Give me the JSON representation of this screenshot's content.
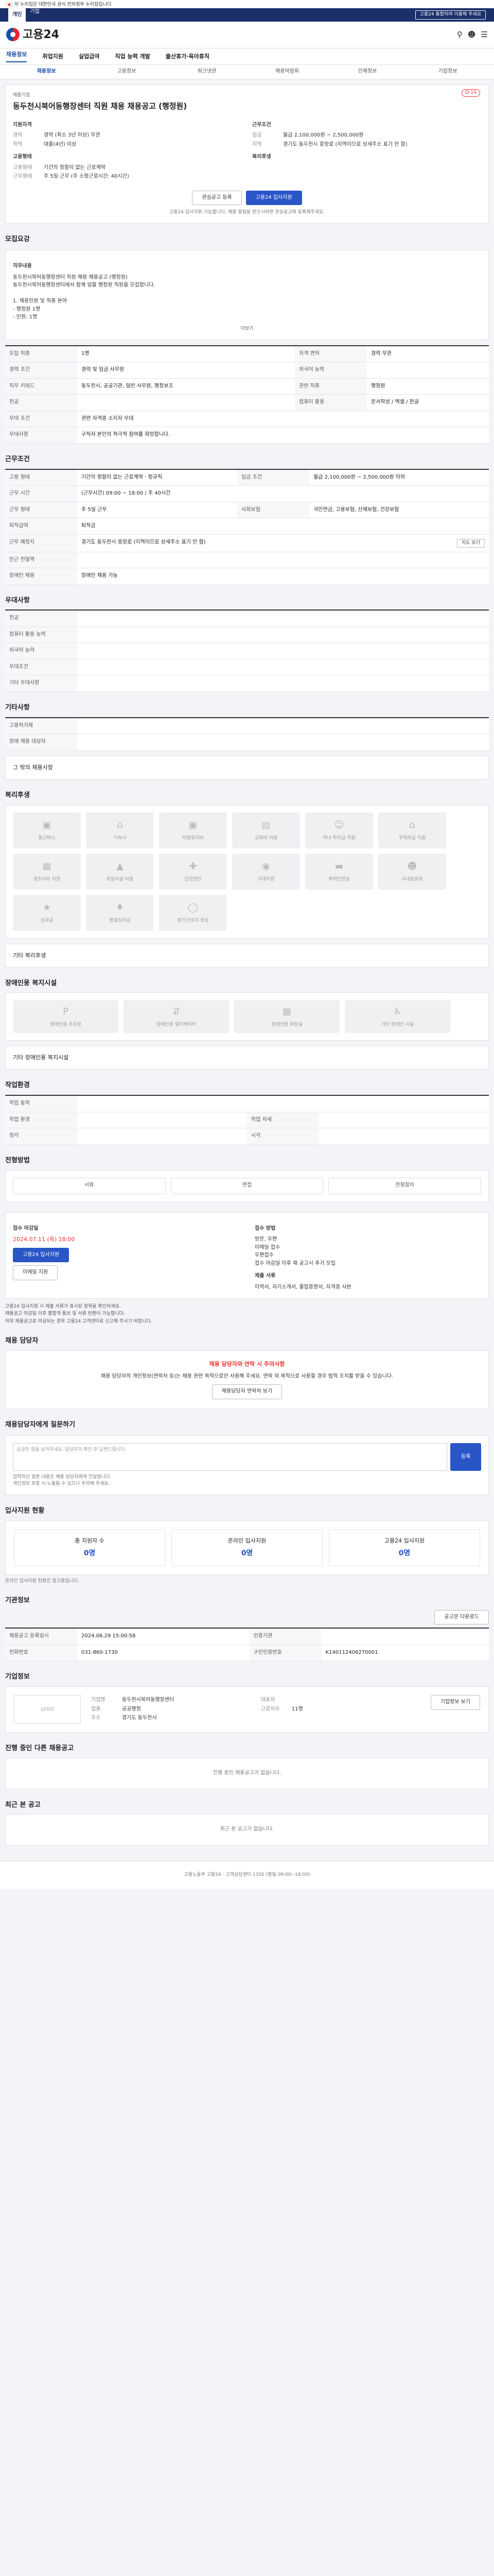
{
  "gov_banner": "이 누리집은 대한민국 공식 전자정부 누리집입니다.",
  "util": {
    "tabs": [
      "개인",
      "기업"
    ],
    "right": "고용24 통합하여 이용해 주세요"
  },
  "logo": "고용24",
  "gnb": [
    "채용정보",
    "취업지원",
    "실업급여",
    "직업 능력 개발",
    "출산휴가·육아휴직"
  ],
  "subnav": [
    "채용정보",
    "고용정보",
    "워크넷관",
    "채용박람회",
    "인재정보",
    "기업정보"
  ],
  "job": {
    "company": "채용기업",
    "title": "동두천시북어동행장센터 직원 채용 채용공고 (행정원)",
    "badge": "D-14",
    "left_title": "지원자격",
    "left": [
      [
        "경력",
        "경력 (최소 3년 이상) 무관"
      ],
      [
        "학력",
        "대졸(4년) 이상"
      ]
    ],
    "right_title": "근무조건",
    "right": [
      [
        "임금",
        "월급 2,100,000원 ~ 2,500,000원"
      ],
      [
        "지역",
        "경기도 동두천시 중앙로 (지역이므로 상세주소 표기 안 함)"
      ]
    ],
    "bottom_left_title": "고용형태",
    "bottom_left": [
      [
        "고용형태",
        "기간의 정함이 없는 근로계약"
      ],
      [
        "근무형태",
        "주 5일 근무 (주 소정근로시간: 40시간)"
      ]
    ],
    "bottom_right_title": "복리후생",
    "bottom_right": [
      [
        "",
        ""
      ]
    ],
    "save": "관심공고 등록",
    "apply": "고용24 입사지원",
    "note": "고용24 입사지원 가능합니다. 채용 알림을 받으시려면 관심공고에 등록해주세요."
  },
  "s_detail": {
    "title": "모집요강",
    "sub": "직무내용",
    "text": "동두천시북어동행장센터 직원 채용 채용공고 (행정원)\n동두천시북어동행장센터에서 함께 일할 행정원 직원을 모집합니다.\n\n1. 채용인원 및 직종 분야\n  - 행정원 1명\n  - 인원: 1명",
    "more": "더보기"
  },
  "s_rows": [
    [
      "모집 직종",
      "1명"
    ],
    [
      "경력 조건",
      "경력 및 임금 사무원"
    ],
    [
      "직무 키워드",
      "동두천시, 공공기관, 일반 사무원, 행정보조"
    ],
    [
      "관련 직종",
      "행정원"
    ],
    [
      "우대 조건",
      "관련 자격증 소지자 우대"
    ]
  ],
  "s_rows2": [
    [
      "자격 면허",
      "경력 무관"
    ],
    [
      "외국어 능력",
      ""
    ],
    [
      "전공",
      ""
    ],
    [
      "컴퓨터 활용",
      "문서작성 / 엑셀 / 한글"
    ],
    [
      "우대사항",
      "구직자 본인의 적극적 참여를 희망합니다."
    ]
  ],
  "s_cond": {
    "title": "근무조건",
    "rows": [
      [
        "고용 형태",
        "기간의 정함이 없는 근로계약 · 정규직"
      ],
      [
        "임금 조건",
        "월급 2,100,000원 ~ 2,500,000원 이하"
      ],
      [
        "근무 시간",
        "(근무시간) 09:00 ~ 18:00 / 주 40시간"
      ],
      [
        "근무 형태",
        "주 5일 근무"
      ],
      [
        "사회보험",
        "국민연금, 고용보험, 산재보험, 건강보험"
      ],
      [
        "퇴직급여",
        "퇴직금"
      ],
      [
        "근무 예정지",
        "경기도 동두천시 중앙로 (지역이므로 상세주소 표기 안 함)"
      ],
      [
        "인근 전철역",
        ""
      ],
      [
        "장애인 채용",
        "장애인 채용 가능"
      ]
    ],
    "map_btn": "지도 보기"
  },
  "s_qual": {
    "title": "우대사항",
    "rows": [
      [
        "전공",
        ""
      ],
      [
        "컴퓨터 활용 능력",
        ""
      ],
      [
        "외국어 능력",
        ""
      ],
      [
        "우대조건",
        ""
      ],
      [
        "기타 우대사항",
        ""
      ]
    ]
  },
  "s_etc": {
    "title": "기타사항",
    "rows": [
      [
        "고용허가제",
        ""
      ],
      [
        "장애 채용 대상자",
        ""
      ]
    ],
    "extra": "그 밖의 채용사항"
  },
  "s_welfare": {
    "title": "복리후생",
    "items": [
      "통근버스",
      "기숙사",
      "차량유지비",
      "교육비 지원",
      "자녀 학자금 지원",
      "주택자금 지원",
      "경조사비 지원",
      "휴양시설 이용",
      "건강검진",
      "식대지원",
      "체력단련실",
      "사내동호회",
      "성과급",
      "명절상여금",
      "장기근속자 포상"
    ],
    "extra": "기타 복리후생"
  },
  "s_disabled": {
    "title": "장애인용 복지시설",
    "items": [
      "장애인용 주차장",
      "장애인용 엘리베이터",
      "장애인용 화장실",
      "기타 장애인 시설"
    ],
    "extra": "기타 장애인용 복지시설"
  },
  "s_env": {
    "title": "작업환경",
    "rows": [
      [
        "작업 동작",
        ""
      ],
      [
        "작업 환경",
        ""
      ],
      [
        "작업 자세",
        ""
      ],
      [
        "청각",
        ""
      ],
      [
        "시각",
        ""
      ]
    ]
  },
  "s_proc": {
    "title": "전형방법",
    "opts": [
      "서류",
      "면접",
      "전형절차"
    ]
  },
  "s_apply": {
    "title": "접수 마감일",
    "deadline": "2024.07.11 (목) 18:00",
    "btn1": "고용24 입사지원",
    "btn2": "이메일 지원",
    "method_title": "접수 방법",
    "methods": [
      "방문, 우편",
      "이메일 접수",
      "우편접수",
      "접수 마감일 이후 재 공고시 추가 모집"
    ],
    "docs_title": "제출 서류",
    "docs": [
      "이력서, 자기소개서, 졸업증명서, 자격증 사본"
    ]
  },
  "warn": [
    "고용24 입사지원 시 제출 서류가 표시된 항목을 확인하세요.",
    "채용공고 마감일 이후 불합격 통보 및 서류 반환이 가능합니다.",
    "허위 채용공고로 의심되는 경우 고용24 고객센터로 신고해 주시기 바랍니다."
  ],
  "s_contact": {
    "title": "채용 담당자",
    "warn": "채용 담당자와 연락 시 주의사항",
    "text": "채용 담당자의 개인정보(연락처 등)는 채용 관련 목적으로만 사용해 주세요. 연락 외 목적으로 사용할 경우 법적 조치를 받을 수 있습니다.",
    "btn": "채용담당자 연락처 보기"
  },
  "s_inquiry": {
    "title": "채용담당자에게 질문하기",
    "placeholder": "궁금한 점을 남겨주세요. 담당자가 확인 후 답변드립니다.",
    "btn": "등록",
    "notes": [
      "입력하신 질문 내용은 채용 담당자에게 전달됩니다.",
      "개인정보 포함 시 노출될 수 있으니 주의해 주세요."
    ]
  },
  "s_stats": {
    "title": "입사지원 현황",
    "items": [
      [
        "총 지원자 수",
        "0명"
      ],
      [
        "온라인 입사지원",
        "0명"
      ],
      [
        "고용24 입사지원",
        "0명"
      ]
    ],
    "note": "온라인 입사지원 현황은 참고용입니다."
  },
  "s_info": {
    "title": "기관정보",
    "rows": [
      [
        "채용공고 등록일시",
        "2024.06.29 15:00:58"
      ],
      [
        "인증기관",
        ""
      ],
      [
        "전화번호",
        "031-860-1730"
      ],
      [
        "구인인증번호",
        "K140112406270001"
      ]
    ],
    "btn": "공고문 다운로드"
  },
  "s_company": {
    "title": "기업정보",
    "logo": "LOGO",
    "rows": [
      [
        "기업명",
        "동두천시북어동행장센터"
      ],
      [
        "업종",
        "공공행정"
      ],
      [
        "대표자",
        ""
      ],
      [
        "근로자수",
        "11명"
      ],
      [
        "주소",
        "경기도 동두천시"
      ]
    ],
    "btn": "기업정보 보기"
  },
  "s_related": {
    "title": "진행 중인 다른 채용공고",
    "empty": "진행 중인 채용공고가 없습니다."
  },
  "s_recent": {
    "title": "최근 본 공고",
    "empty": "최근 본 공고가 없습니다."
  },
  "footer": "고용노동부 고용24 · 고객상담센터 1350 (평일 09:00~18:00)"
}
